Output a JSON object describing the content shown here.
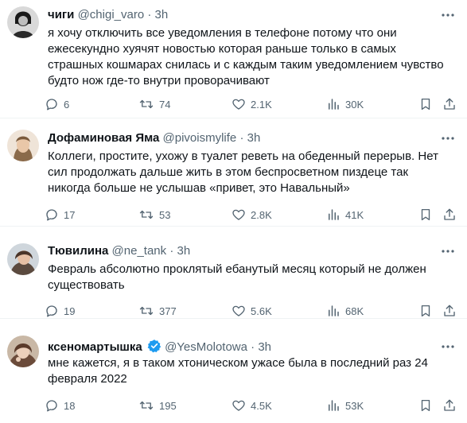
{
  "tweets": [
    {
      "name": "чиги",
      "handle": "@chigi_varo",
      "dot": "·",
      "time": "3h",
      "text": "я хочу отключить все уведомления в телефоне потому что они ежесекундно хуячят новостью которая раньше только в самых страшных кошмарах снилась и с каждым таким уведомлением чувство будто нож где-то внутри проворачивают",
      "replies": "6",
      "retweets": "74",
      "likes": "2.1K",
      "views": "30K"
    },
    {
      "name": "Дофаминовая Яма",
      "handle": "@pivoismylife",
      "dot": "·",
      "time": "3h",
      "text": "Коллеги, простите, ухожу в туалет реветь на обеденный перерыв. Нет сил продолжать дальше жить в этом беспросветном пиздеце так никогда больше не услышав «привет, это Навальный»",
      "replies": "17",
      "retweets": "53",
      "likes": "2.8K",
      "views": "41K"
    },
    {
      "name": "Тювилина",
      "handle": "@ne_tank",
      "dot": "·",
      "time": "3h",
      "text": "Февраль абсолютно проклятый ебанутый месяц который не должен существовать",
      "replies": "19",
      "retweets": "377",
      "likes": "5.6K",
      "views": "68K"
    },
    {
      "name": "ксеномартышка",
      "handle": "@YesMolotowa",
      "dot": "·",
      "time": "3h",
      "text": "мне кажется, я в таком хтоническом ужасе была в последний раз 24 февраля 2022",
      "replies": "18",
      "retweets": "195",
      "likes": "4.5K",
      "views": "53K"
    }
  ],
  "icons": {
    "reply": "reply-icon",
    "retweet": "retweet-icon",
    "like": "heart-icon",
    "views": "views-icon",
    "bookmark": "bookmark-icon",
    "share": "share-icon",
    "more": "more-icon",
    "verified": "verified-badge-icon"
  },
  "colors": {
    "text": "#0f1419",
    "secondary": "#536471",
    "divider": "#eff3f4",
    "verified": "#1d9bf0"
  }
}
